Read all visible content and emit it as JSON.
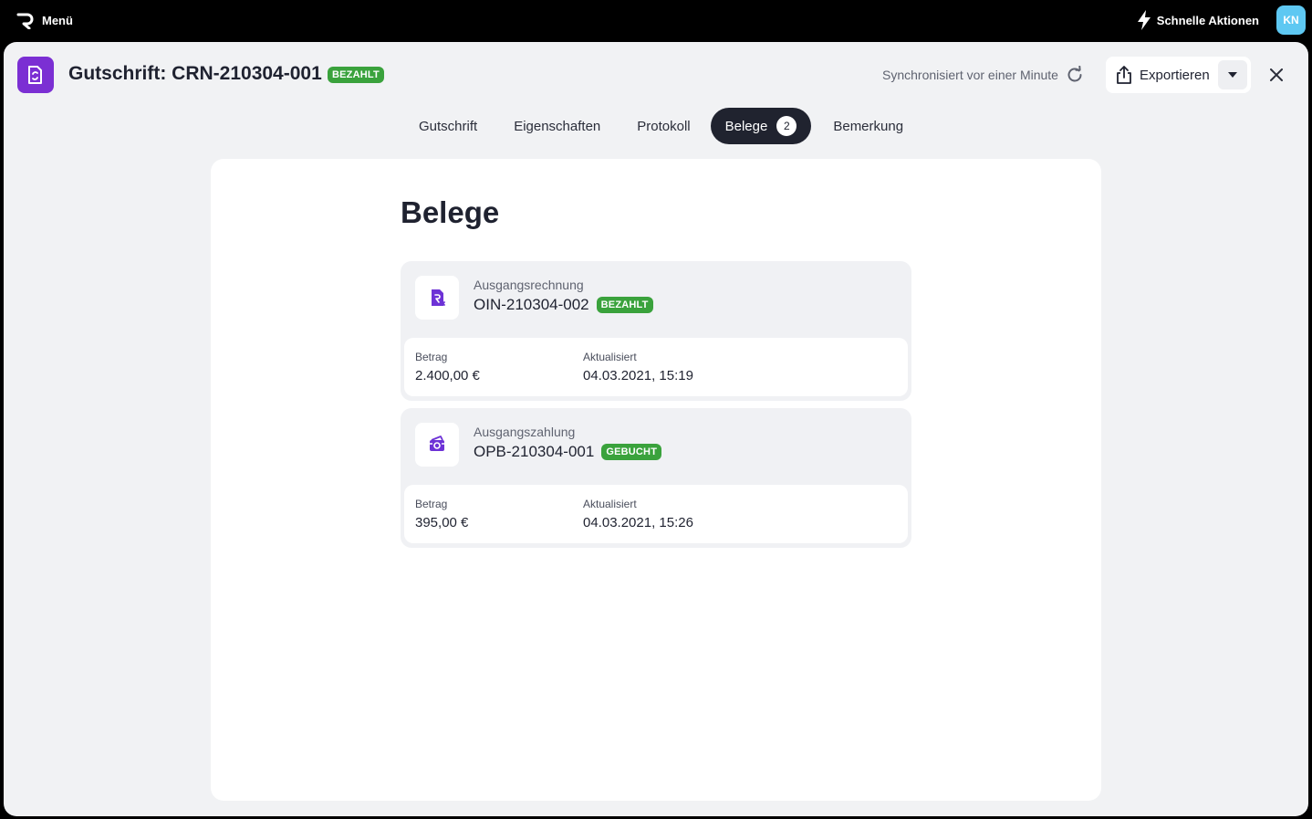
{
  "topbar": {
    "menu_label": "Menü",
    "quick_actions_label": "Schnelle Aktionen",
    "avatar_initials": "KN",
    "avatar_color": "#5ec8f2"
  },
  "header": {
    "title": "Gutschrift: CRN-210304-001",
    "status": "BEZAHLT",
    "sync_text": "Synchronisiert vor einer Minute",
    "export_label": "Exportieren",
    "accent_color": "#7b2fd3"
  },
  "tabs": [
    {
      "label": "Gutschrift"
    },
    {
      "label": "Eigenschaften"
    },
    {
      "label": "Protokoll"
    },
    {
      "label": "Belege",
      "count": "2",
      "active": true
    },
    {
      "label": "Bemerkung"
    }
  ],
  "main": {
    "section_title": "Belege",
    "documents": [
      {
        "type": "Ausgangsrechnung",
        "number": "OIN-210304-002",
        "status": "BEZAHLT",
        "icon": "invoice-icon",
        "amount_label": "Betrag",
        "amount": "2.400,00 €",
        "updated_label": "Aktualisiert",
        "updated": "04.03.2021, 15:19"
      },
      {
        "type": "Ausgangszahlung",
        "number": "OPB-210304-001",
        "status": "GEBUCHT",
        "icon": "payment-icon",
        "amount_label": "Betrag",
        "amount": "395,00 €",
        "updated_label": "Aktualisiert",
        "updated": "04.03.2021, 15:26"
      }
    ]
  }
}
